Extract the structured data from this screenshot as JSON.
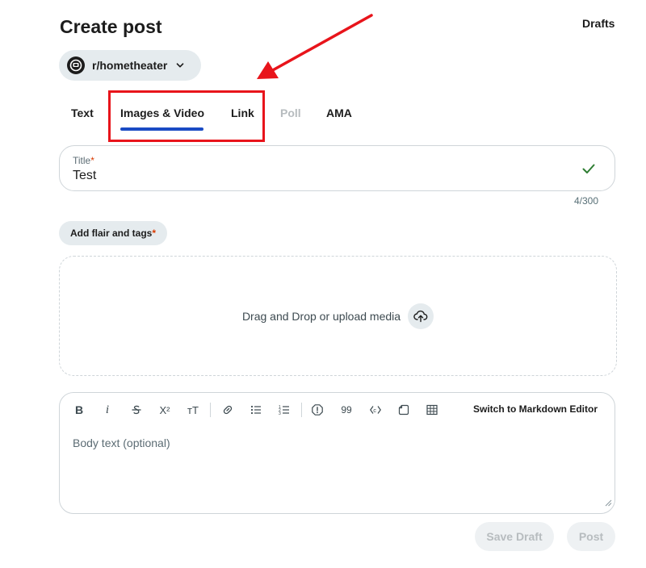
{
  "header": {
    "title": "Create post",
    "drafts_label": "Drafts"
  },
  "community": {
    "name": "r/hometheater",
    "icon": "community-avatar-icon"
  },
  "tabs": [
    {
      "label": "Text",
      "state": "enabled"
    },
    {
      "label": "Images & Video",
      "state": "selected"
    },
    {
      "label": "Link",
      "state": "enabled"
    },
    {
      "label": "Poll",
      "state": "disabled"
    },
    {
      "label": "AMA",
      "state": "enabled"
    }
  ],
  "title_field": {
    "label": "Title",
    "required_marker": "*",
    "value": "Test",
    "char_count": "4/300"
  },
  "flair": {
    "label": "Add flair and tags",
    "required_marker": "*"
  },
  "media": {
    "dropzone_text": "Drag and Drop or upload media"
  },
  "editor": {
    "toolbar_icons": [
      "bold-icon",
      "italic-icon",
      "strikethrough-icon",
      "superscript-icon",
      "heading-icon",
      "link-icon",
      "bulleted-list-icon",
      "numbered-list-icon",
      "spoiler-icon",
      "quote-icon",
      "code-icon",
      "code-block-icon",
      "table-icon"
    ],
    "italic_glyph": "i",
    "superscript_glyph": "X²",
    "heading_glyph": "тT",
    "quote_glyph": "99",
    "markdown_toggle": "Switch to Markdown Editor",
    "body_placeholder": "Body text (optional)"
  },
  "actions": {
    "save_draft": "Save Draft",
    "post": "Post"
  },
  "colors": {
    "accent_underline": "#1a4bc4",
    "annotation_red": "#e8141b",
    "check_green": "#2e7d32"
  }
}
